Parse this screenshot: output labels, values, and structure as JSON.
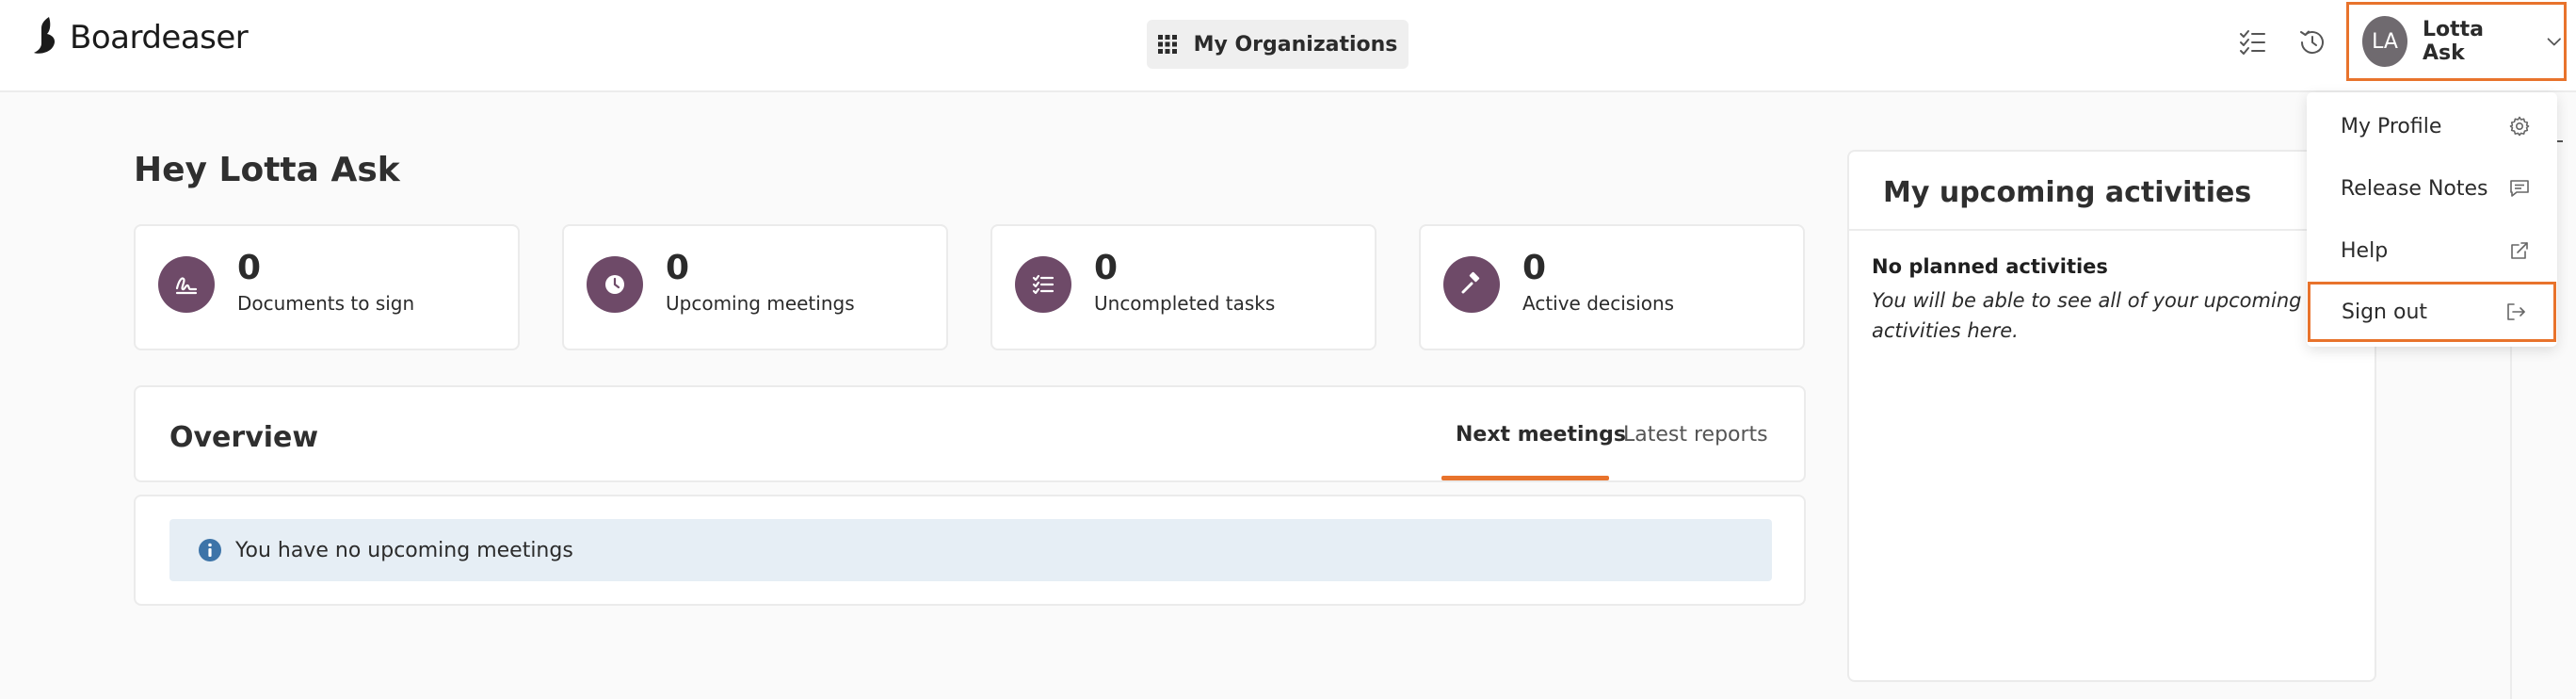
{
  "header": {
    "logo_text": "Boardeaser",
    "org_button_label": "My Organizations",
    "user": {
      "initials": "LA",
      "name": "Lotta Ask"
    }
  },
  "main": {
    "greeting": "Hey Lotta Ask",
    "stats": [
      {
        "value": "0",
        "label": "Documents to sign",
        "icon": "signature-icon"
      },
      {
        "value": "0",
        "label": "Upcoming meetings",
        "icon": "clock-icon"
      },
      {
        "value": "0",
        "label": "Uncompleted tasks",
        "icon": "checklist-icon"
      },
      {
        "value": "0",
        "label": "Active decisions",
        "icon": "gavel-icon"
      }
    ],
    "overview": {
      "title": "Overview",
      "tabs": [
        {
          "label": "Next meetings",
          "active": true
        },
        {
          "label": "Latest reports",
          "active": false
        }
      ],
      "empty_message": "You have no upcoming meetings"
    }
  },
  "activities": {
    "title": "My upcoming activities",
    "empty_heading": "No planned activities",
    "empty_text": "You will be able to see all of your upcoming activities here."
  },
  "user_menu": {
    "items": [
      {
        "label": "My Profile",
        "icon": "gear-icon"
      },
      {
        "label": "Release Notes",
        "icon": "message-icon"
      },
      {
        "label": "Help",
        "icon": "external-link-icon"
      },
      {
        "label": "Sign out",
        "icon": "sign-out-icon"
      }
    ]
  },
  "colors": {
    "accent": "#e8732c",
    "stat_icon_bg": "#6e4a68",
    "avatar_bg": "#6f6a6f",
    "info_banner_bg": "#e6eef5",
    "info_icon": "#3d74a8"
  }
}
